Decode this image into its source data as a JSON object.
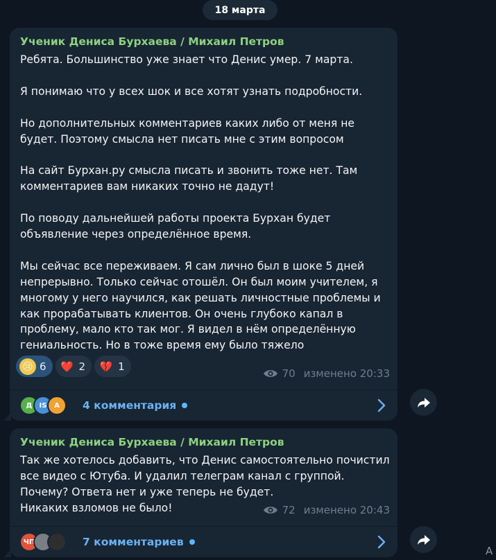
{
  "date_separator": "18 марта",
  "messages": [
    {
      "author": "Ученик Дениса Бурхаева / Михаил Петров",
      "text": "Ребята. Большинство уже знает что Денис умер. 7 марта.\n\nЯ понимаю что у всех шок и все хотят узнать подробности.\n\nНо дополнительных комментариев каких либо от меня не\nбудет. Поэтому смысла нет писать мне с этим вопросом\n\nНа сайт Бурхан.ру смысла писать и звонить тоже нет. Там\nкомментариев вам никаких точно не дадут!\n\nПо поводу дальнейшей работы проекта Бурхан будет\nобъявление через определённое время.\n\nМы сейчас все переживаем. Я сам лично был в шоке 5 дней\nнепрерывно. Только сейчас отошёл. Он был моим учителем, я\nмногому у него научился, как решать личностные проблемы и\nкак прорабатывать клиентов. Он очень глубоко капал в\nпроблему, мало кто так мог. Я видел в нём определённую\nгениальность. Но в тоже время ему было тяжело",
      "reactions": [
        {
          "emoji": "😢",
          "count": "6",
          "active": true
        },
        {
          "emoji": "❤️",
          "count": "2",
          "active": false
        },
        {
          "emoji": "💔",
          "count": "1",
          "active": false
        }
      ],
      "views": "70",
      "edited_time": "изменено 20:33",
      "comments_label": "4 комментария",
      "commenter_avatars": [
        {
          "initials": "Д",
          "color": "#56b04a"
        },
        {
          "initials": "IS",
          "color": "#4a90d9"
        },
        {
          "initials": "А",
          "color": "#f0a233"
        }
      ]
    },
    {
      "author": "Ученик Дениса Бурхаева / Михаил Петров",
      "text": "Так же хотелось добавить, что Денис самостоятельно почистил\nвсе видео с Ютуба. И удалил телеграм канал с группой.\nПочему? Ответа нет и уже теперь не будет.\nНикаких взломов не было!",
      "views": "72",
      "edited_time": "изменено 20:43",
      "comments_label": "7 комментариев",
      "commenter_avatars": [
        {
          "initials": "ЧП",
          "color": "#e0533d"
        },
        {
          "initials": "",
          "color": "#7a7f85"
        },
        {
          "initials": "",
          "color": "#2e2e2e"
        }
      ]
    }
  ],
  "edge_glyph": "A",
  "colors": {
    "background": "#0e1621",
    "bubble": "#182533",
    "author": "#8cd27f",
    "link": "#6ab2f2",
    "meta": "#6d7f8f"
  },
  "icons": {
    "views": "eye-icon",
    "comments_arrow": "chevron-right-icon",
    "share": "share-arrow-icon"
  }
}
